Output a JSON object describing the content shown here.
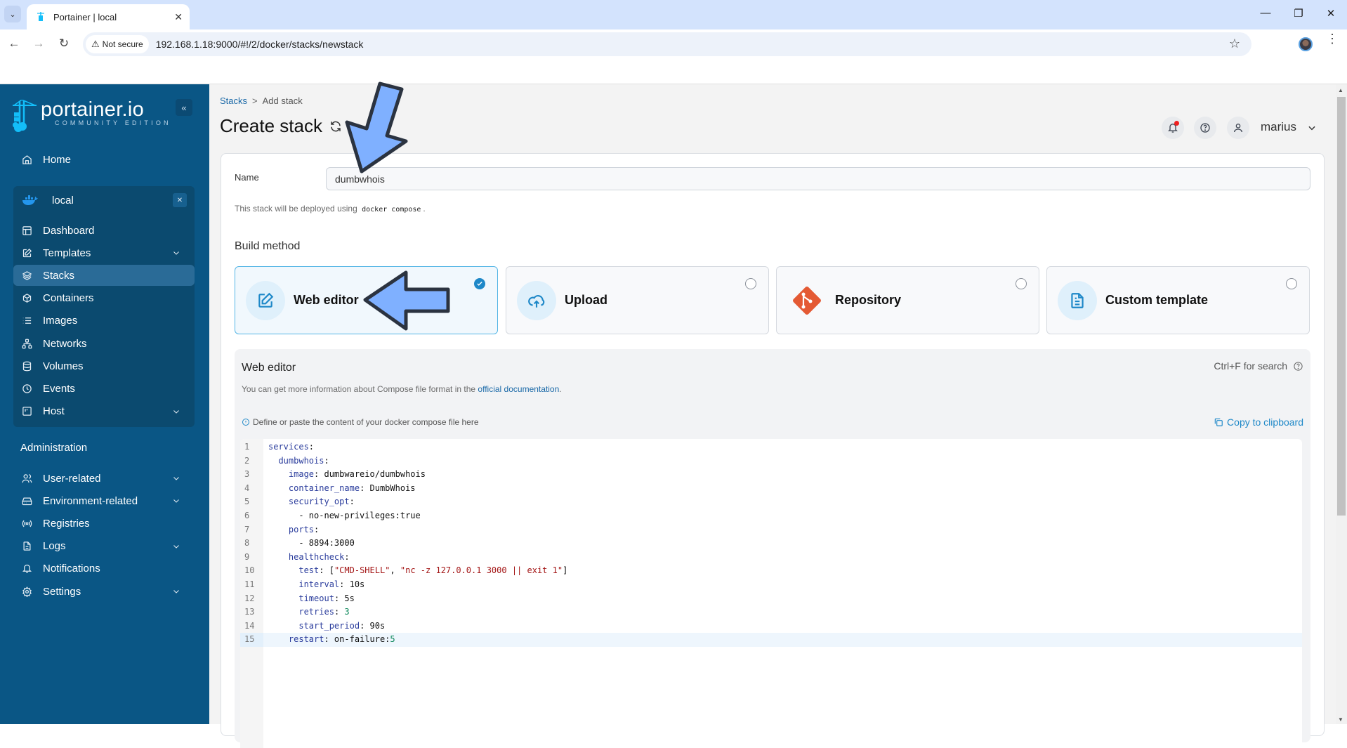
{
  "browser": {
    "tab_title": "Portainer | local",
    "security_label": "Not secure",
    "url": "192.168.1.18:9000/#!/2/docker/stacks/newstack"
  },
  "sidebar": {
    "logo_main": "portainer.io",
    "logo_sub": "COMMUNITY EDITION",
    "home": "Home",
    "environment": "local",
    "env_items": [
      {
        "label": "Dashboard",
        "icon": "dashboard-icon"
      },
      {
        "label": "Templates",
        "icon": "edit-icon",
        "expandable": true
      },
      {
        "label": "Stacks",
        "icon": "layers-icon",
        "active": true
      },
      {
        "label": "Containers",
        "icon": "box-icon"
      },
      {
        "label": "Images",
        "icon": "list-icon"
      },
      {
        "label": "Networks",
        "icon": "network-icon"
      },
      {
        "label": "Volumes",
        "icon": "database-icon"
      },
      {
        "label": "Events",
        "icon": "clock-icon"
      },
      {
        "label": "Host",
        "icon": "host-icon",
        "expandable": true
      }
    ],
    "admin_heading": "Administration",
    "admin_items": [
      {
        "label": "User-related",
        "icon": "users-icon",
        "expandable": true
      },
      {
        "label": "Environment-related",
        "icon": "hard-drive-icon",
        "expandable": true
      },
      {
        "label": "Registries",
        "icon": "radio-icon"
      },
      {
        "label": "Logs",
        "icon": "file-icon",
        "expandable": true
      },
      {
        "label": "Notifications",
        "icon": "bell-icon"
      },
      {
        "label": "Settings",
        "icon": "gear-icon",
        "expandable": true
      }
    ]
  },
  "header": {
    "breadcrumb_root": "Stacks",
    "breadcrumb_sep": ">",
    "breadcrumb_current": "Add stack",
    "title": "Create stack",
    "username": "marius"
  },
  "form": {
    "name_label": "Name",
    "name_value": "dumbwhois",
    "deploy_hint_prefix": "This stack will be deployed using",
    "deploy_hint_code": "docker compose",
    "deploy_hint_suffix": ".",
    "build_method_heading": "Build method",
    "build_methods": [
      {
        "label": "Web editor",
        "selected": true
      },
      {
        "label": "Upload",
        "selected": false
      },
      {
        "label": "Repository",
        "selected": false
      },
      {
        "label": "Custom template",
        "selected": false
      }
    ]
  },
  "editor": {
    "title": "Web editor",
    "search_hint": "Ctrl+F for search",
    "info_prefix": "You can get more information about Compose file format in the",
    "info_link": "official documentation",
    "info_suffix": ".",
    "define_hint": "Define or paste the content of your docker compose file here",
    "copy_label": "Copy to clipboard",
    "active_line": 15,
    "lines": [
      "services:",
      "  dumbwhois:",
      "    image: dumbwareio/dumbwhois",
      "    container_name: DumbWhois",
      "    security_opt:",
      "      - no-new-privileges:true",
      "    ports:",
      "      - 8894:3000",
      "    healthcheck:",
      "      test: [\"CMD-SHELL\", \"nc -z 127.0.0.1 3000 || exit 1\"]",
      "      interval: 10s",
      "      timeout: 5s",
      "      retries: 3",
      "      start_period: 90s",
      "    restart: on-failure:5"
    ]
  },
  "colors": {
    "sidebar_bg": "#0a5685",
    "accent": "#1e88c8",
    "annotation_arrow": "#7fb0ff"
  }
}
